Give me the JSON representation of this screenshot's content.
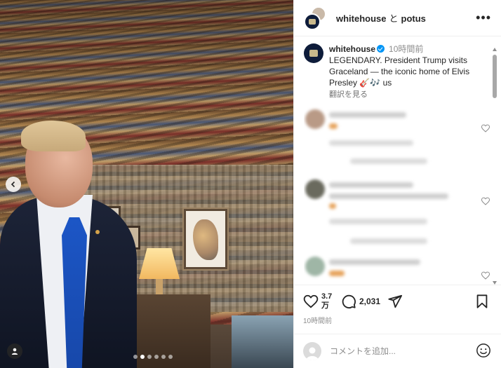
{
  "header": {
    "user_primary": "whitehouse",
    "separator": "と",
    "user_secondary": "potus",
    "more_icon": "more-horizontal-icon"
  },
  "caption": {
    "username": "whitehouse",
    "verified": true,
    "time": "10時間前",
    "text": "LEGENDARY. President Trump visits Graceland — the iconic home of Elvis Presley 🎸🎶 us",
    "translate_link": "翻訳を見る"
  },
  "actions": {
    "like_count": "3.7万",
    "comment_count": "2,031",
    "timestamp": "10時間前"
  },
  "add_comment": {
    "placeholder": "コメントを追加..."
  },
  "carousel": {
    "total": 6,
    "active": 1
  },
  "colors": {
    "verified": "#0095f6",
    "text": "#262626",
    "muted": "#8e8e8e",
    "tie": "#1c56c6"
  }
}
